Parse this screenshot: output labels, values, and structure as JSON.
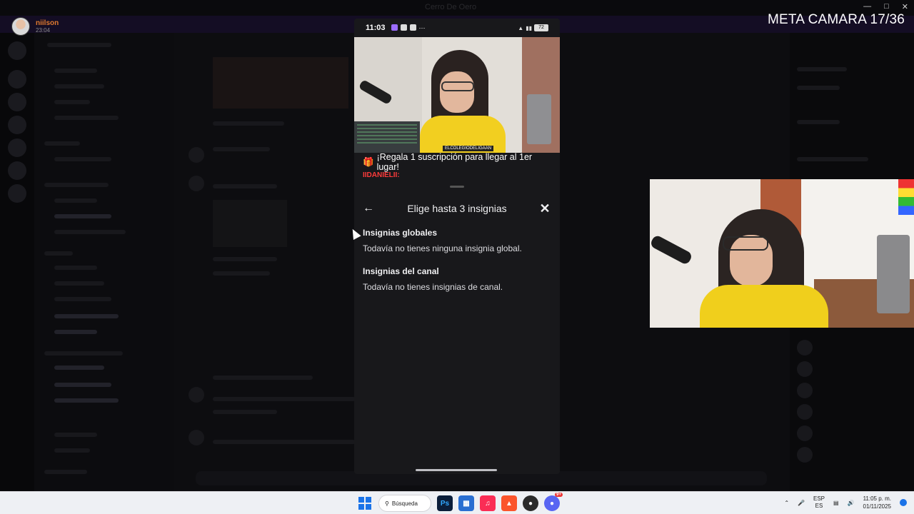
{
  "window": {
    "title": "Cerro De Oero"
  },
  "user": {
    "name": "niilson",
    "time": "23:04"
  },
  "overlay": {
    "meta_label": "META CAMARA 17/36"
  },
  "phone": {
    "status": {
      "clock": "11:03",
      "battery": "72"
    },
    "stream": {
      "banner_text": "¡Regala 1 suscripción para llegar al 1er lugar!",
      "chat_user": "IIDANIELII:",
      "cam_tag": "ELCOLEGIODELIGAAN"
    },
    "sheet": {
      "title": "Elige hasta 3 insignias",
      "sections": [
        {
          "title": "Insignias globales",
          "description": "Todavía no tienes ninguna insignia global."
        },
        {
          "title": "Insignias del canal",
          "description": "Todavía no tienes insignias de canal."
        }
      ]
    }
  },
  "taskbar": {
    "search_label": "Búsqueda",
    "language": "ESP",
    "language_sub": "ES",
    "time": "11:05 p. m.",
    "date": "01/11/2025",
    "discord_badge": "9+"
  },
  "colors": {
    "accent_purple": "#9b6cff",
    "shirt_yellow": "#f2cf20",
    "chat_red": "#ff3b3b",
    "windows_blue": "#1a73e8"
  },
  "icons": [
    "back-arrow-icon",
    "close-icon",
    "gift-icon",
    "search-icon",
    "windows-icon",
    "photoshop-icon",
    "store-icon",
    "music-icon",
    "brave-icon",
    "discord-icon",
    "microphone-icon",
    "volume-icon",
    "notification-icon",
    "chevron-up-icon"
  ]
}
